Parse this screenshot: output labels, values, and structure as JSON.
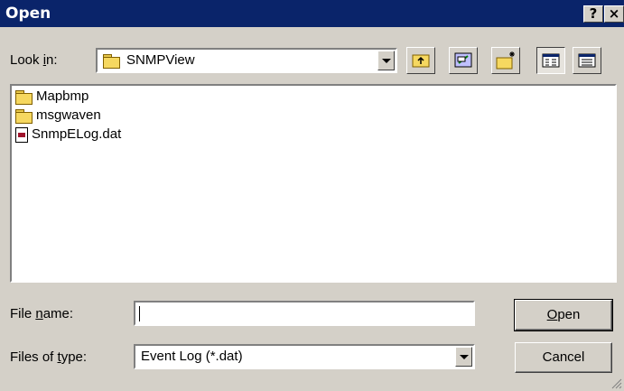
{
  "window": {
    "title": "Open",
    "help_label": "?",
    "close_label": "×"
  },
  "look_in": {
    "label_pre": "Look ",
    "label_key": "i",
    "label_post": "n:",
    "value": "SNMPView"
  },
  "toolbar": {
    "up_icon": "up-one-level-icon",
    "desktop_icon": "desktop-icon",
    "new_folder_icon": "new-folder-icon",
    "list_view_icon": "list-view-icon",
    "details_view_icon": "details-view-icon"
  },
  "files": [
    {
      "name": "Mapbmp",
      "type": "folder"
    },
    {
      "name": "msgwaven",
      "type": "folder"
    },
    {
      "name": "SnmpELog.dat",
      "type": "file"
    }
  ],
  "file_name": {
    "label_pre": "File ",
    "label_key": "n",
    "label_post": "ame:",
    "value": ""
  },
  "file_type": {
    "label_pre": "Files of ",
    "label_key": "t",
    "label_post": "ype:",
    "value": "Event Log (*.dat)"
  },
  "buttons": {
    "open_key": "O",
    "open_rest": "pen",
    "cancel": "Cancel"
  }
}
